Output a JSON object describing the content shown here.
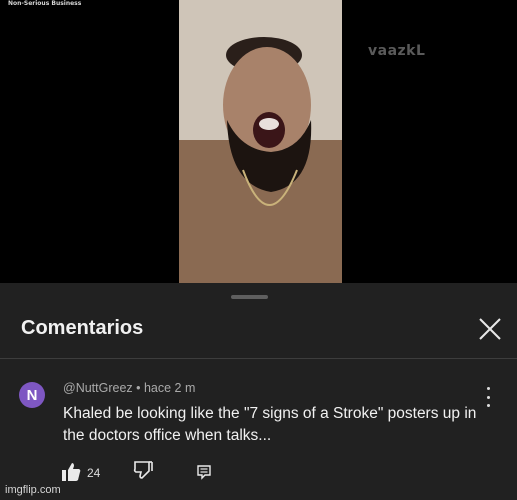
{
  "video": {
    "channel_tag": "Non-Serious Business",
    "watermark": "vaazkL"
  },
  "comments_sheet": {
    "title": "Comentarios",
    "close_icon": "close-icon"
  },
  "comment": {
    "avatar_letter": "N",
    "avatar_color": "#7e57c2",
    "meta": "@NuttGreez • hace 2 m",
    "text": "Khaled be looking like the \"7 signs of a Stroke\" posters up in the doctors office when talks...",
    "like_count": "24",
    "icons": [
      "like-icon",
      "dislike-icon",
      "reply-icon",
      "more-vert-icon"
    ]
  },
  "footer": {
    "imgflip_watermark": "imgflip.com"
  }
}
